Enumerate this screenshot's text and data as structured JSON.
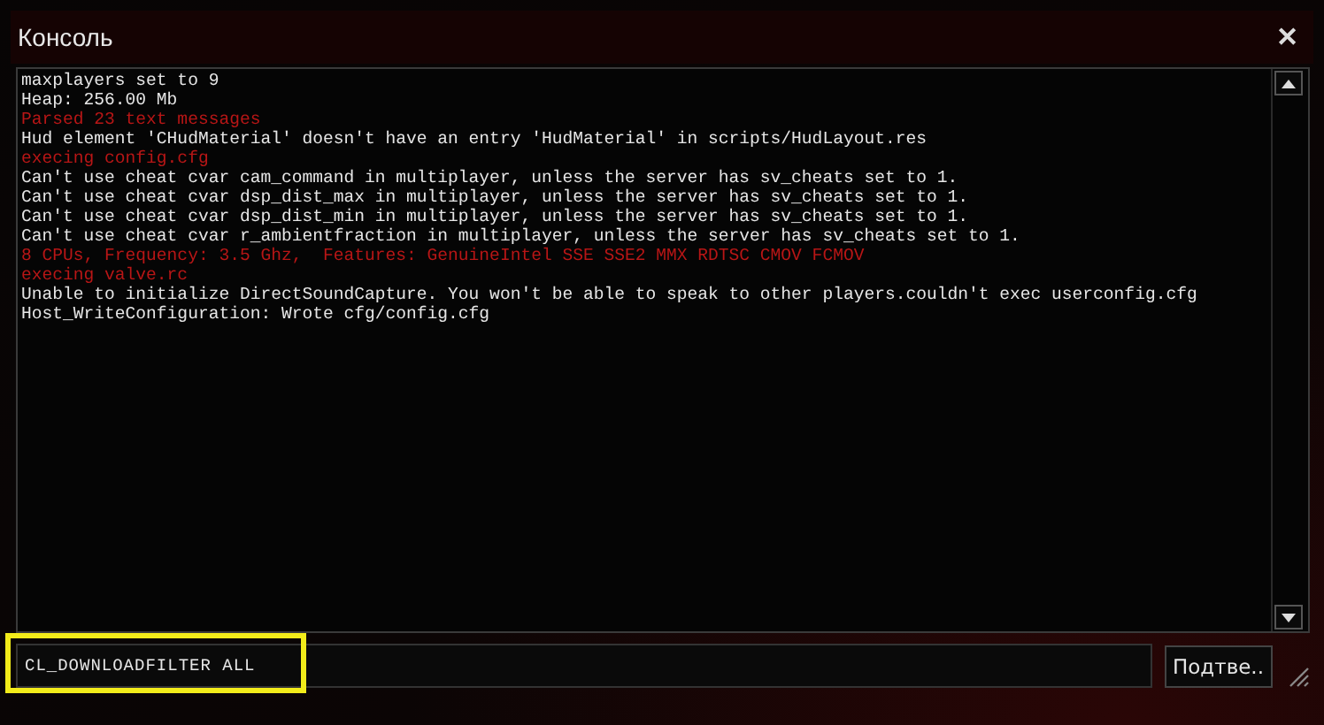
{
  "window": {
    "title": "Консоль",
    "close": "✕"
  },
  "log": [
    {
      "text": "maxplayers set to 9",
      "kind": "info"
    },
    {
      "text": "Heap: 256.00 Mb",
      "kind": "info"
    },
    {
      "text": "Parsed 23 text messages",
      "kind": "error"
    },
    {
      "text": "Hud element 'CHudMaterial' doesn't have an entry 'HudMaterial' in scripts/HudLayout.res",
      "kind": "info"
    },
    {
      "text": "execing config.cfg",
      "kind": "error"
    },
    {
      "text": "Can't use cheat cvar cam_command in multiplayer, unless the server has sv_cheats set to 1.",
      "kind": "info"
    },
    {
      "text": "Can't use cheat cvar dsp_dist_max in multiplayer, unless the server has sv_cheats set to 1.",
      "kind": "info"
    },
    {
      "text": "Can't use cheat cvar dsp_dist_min in multiplayer, unless the server has sv_cheats set to 1.",
      "kind": "info"
    },
    {
      "text": "Can't use cheat cvar r_ambientfraction in multiplayer, unless the server has sv_cheats set to 1.",
      "kind": "info"
    },
    {
      "text": "8 CPUs, Frequency: 3.5 Ghz,  Features: GenuineIntel SSE SSE2 MMX RDTSC CMOV FCMOV",
      "kind": "error"
    },
    {
      "text": "execing valve.rc",
      "kind": "error"
    },
    {
      "text": "Unable to initialize DirectSoundCapture. You won't be able to speak to other players.couldn't exec userconfig.cfg",
      "kind": "info"
    },
    {
      "text": "Host_WriteConfiguration: Wrote cfg/config.cfg",
      "kind": "info"
    }
  ],
  "command": {
    "value": "CL_DOWNLOADFILTER ALL",
    "highlighted": true
  },
  "submit_button": "Подтве.."
}
